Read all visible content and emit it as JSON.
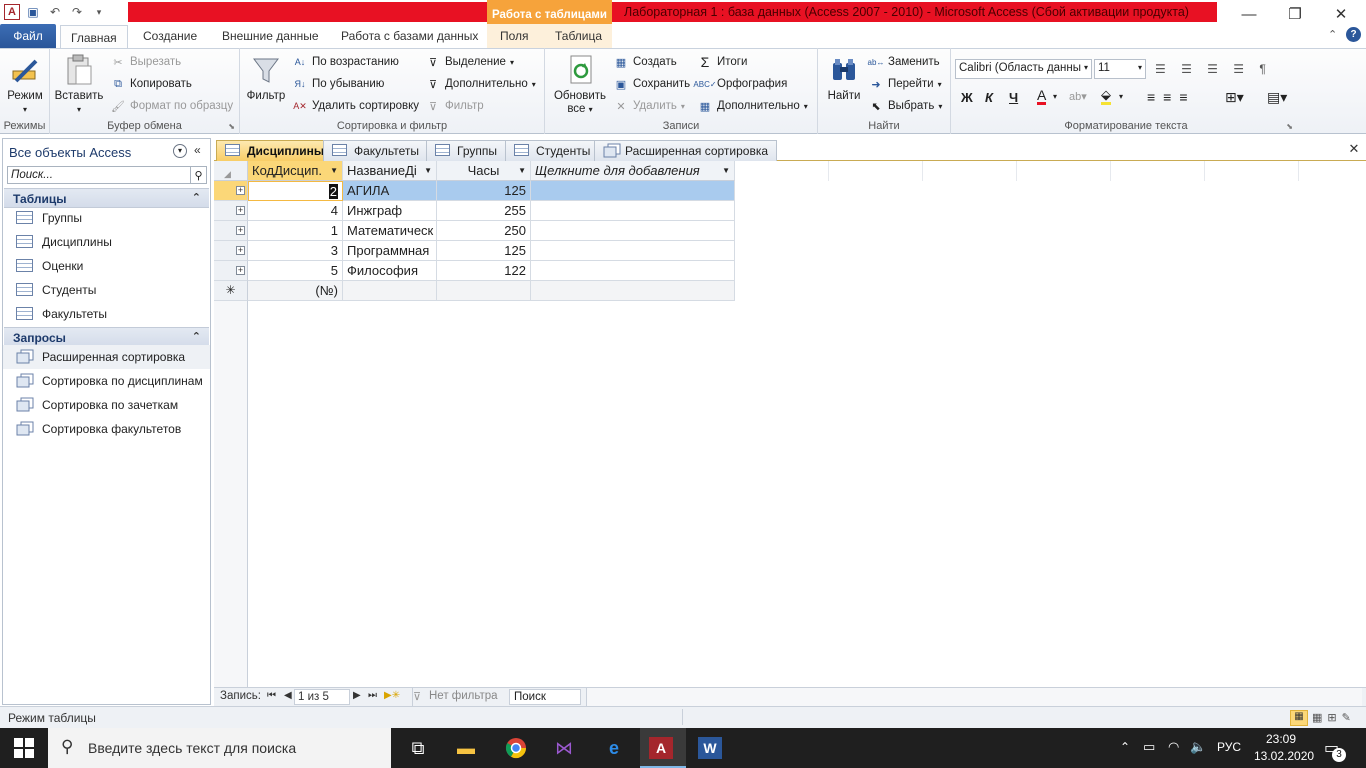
{
  "window": {
    "context_tab_group": "Работа с таблицами",
    "title": "Лабораторная 1 : база данных (Access 2007 - 2010)  -  Microsoft Access (Сбой активации продукта)"
  },
  "ribbon_tabs": {
    "file": "Файл",
    "home": "Главная",
    "create": "Создание",
    "external": "Внешние данные",
    "dbtools": "Работа с базами данных",
    "fields": "Поля",
    "table": "Таблица"
  },
  "groups": {
    "views": {
      "label": "Режимы",
      "view_btn": "Режим"
    },
    "clipboard": {
      "label": "Буфер обмена",
      "paste": "Вставить",
      "cut": "Вырезать",
      "copy": "Копировать",
      "format_painter": "Формат по образцу"
    },
    "sort_filter": {
      "label": "Сортировка и фильтр",
      "filter": "Фильтр",
      "ascending": "По возрастанию",
      "descending": "По убыванию",
      "remove_sort": "Удалить сортировку",
      "selection": "Выделение",
      "advanced": "Дополнительно",
      "toggle_filter": "Фильтр"
    },
    "records": {
      "label": "Записи",
      "refresh_l1": "Обновить",
      "refresh_l2": "все",
      "new": "Создать",
      "save": "Сохранить",
      "delete": "Удалить",
      "totals": "Итоги",
      "spelling": "Орфография",
      "more": "Дополнительно"
    },
    "find": {
      "label": "Найти",
      "find": "Найти",
      "replace": "Заменить",
      "goto": "Перейти",
      "select": "Выбрать"
    },
    "text_format": {
      "label": "Форматирование текста",
      "font": "Calibri (Область данны",
      "size": "11",
      "bold": "Ж",
      "italic": "К",
      "underline": "Ч"
    }
  },
  "nav_pane": {
    "title": "Все объекты Access",
    "search_placeholder": "Поиск...",
    "tables_header": "Таблицы",
    "tables": [
      "Группы",
      "Дисциплины",
      "Оценки",
      "Студенты",
      "Факультеты"
    ],
    "queries_header": "Запросы",
    "queries": [
      "Расширенная сортировка",
      "Сортировка по дисциплинам",
      "Сортировка по зачеткам",
      "Сортировка факультетов"
    ]
  },
  "doc_tabs": [
    "Дисциплины",
    "Факультеты",
    "Группы",
    "Студенты",
    "Расширенная сортировка"
  ],
  "datasheet": {
    "columns": [
      "КодДисцип.",
      "НазваниеДі",
      "Часы",
      "Щелкните для добавления"
    ],
    "rows": [
      {
        "id": "2",
        "name": "АГИЛА",
        "hours": "125"
      },
      {
        "id": "4",
        "name": "Инжграф",
        "hours": "255"
      },
      {
        "id": "1",
        "name": "Математическ",
        "hours": "250"
      },
      {
        "id": "3",
        "name": "Программная",
        "hours": "125"
      },
      {
        "id": "5",
        "name": "Философия",
        "hours": "122"
      }
    ],
    "new_row_id": "(№)"
  },
  "record_nav": {
    "label": "Запись:",
    "position": "1 из 5",
    "no_filter": "Нет фильтра",
    "search": "Поиск"
  },
  "status": {
    "mode": "Режим таблицы"
  },
  "taskbar": {
    "search_placeholder": "Введите здесь текст для поиска",
    "lang": "РУС",
    "time": "23:09",
    "date": "13.02.2020",
    "notifications": "3"
  },
  "colors": {
    "accent_blue": "#2b579a",
    "title_red": "#e81123",
    "context_orange": "#f6a33b",
    "selected_row": "#a9cbee",
    "active_tab": "#fbd778"
  }
}
